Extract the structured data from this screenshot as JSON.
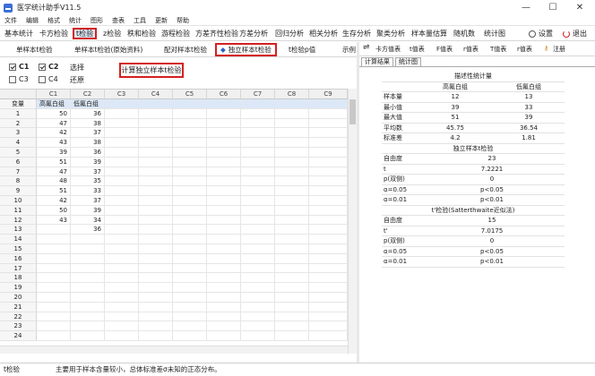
{
  "window": {
    "title": "医学统计助手V11.5",
    "minimize": "—",
    "maximize": "☐",
    "close": "✕"
  },
  "menu": [
    "文件",
    "编辑",
    "格式",
    "统计",
    "图形",
    "查表",
    "工具",
    "更新",
    "帮助"
  ],
  "toolbar": {
    "items": [
      "基本统计",
      "卡方检验",
      "t检验",
      "z检验",
      "秩和检验",
      "游程检验",
      "方差齐性检验",
      "方差分析",
      "回归分析",
      "相关分析",
      "生存分析",
      "聚类分析",
      "样本量估算",
      "随机数",
      "统计图"
    ],
    "active": "t检验",
    "settings": "设置",
    "exit": "退出"
  },
  "subtabs": {
    "items": [
      "单样本t检验",
      "单样本t检验(原始资料)",
      "配对样本t检验",
      "独立样本t检验",
      "t检验p值",
      "示例"
    ],
    "active": "独立样本t检验",
    "active_marker": "◆"
  },
  "options": {
    "c1": {
      "label": "C1",
      "checked": true
    },
    "c2": {
      "label": "C2",
      "checked": true
    },
    "c3": {
      "label": "C3",
      "checked": false
    },
    "c4": {
      "label": "C4",
      "checked": false
    },
    "select": "选择",
    "restore": "还原",
    "calc_button": "计算独立样本t检验"
  },
  "grid": {
    "columns": [
      "C1",
      "C2",
      "C3",
      "C4",
      "C5",
      "C6",
      "C7",
      "C8",
      "C9"
    ],
    "row_header": "变量",
    "var_names": [
      "高氟白组",
      "低氟白组"
    ],
    "c1": [
      50,
      47,
      42,
      43,
      39,
      51,
      47,
      48,
      51,
      42,
      50,
      43,
      ""
    ],
    "c2": [
      36,
      38,
      37,
      38,
      36,
      39,
      37,
      35,
      33,
      37,
      39,
      34,
      36
    ],
    "row_count": 24
  },
  "right_toolbar": {
    "swap": "⇌",
    "items": [
      "卡方值表",
      "t值表",
      "F值表",
      "r值表",
      "T值表",
      "r值表"
    ],
    "register": "注册"
  },
  "result_tabs": [
    "计算结果",
    "统计图"
  ],
  "results": {
    "desc_title": "描述性统计量",
    "group1": "高氟白组",
    "group2": "低氟白组",
    "desc_rows": [
      {
        "label": "样本量",
        "v1": "12",
        "v2": "13"
      },
      {
        "label": "最小值",
        "v1": "39",
        "v2": "33"
      },
      {
        "label": "最大值",
        "v1": "51",
        "v2": "39"
      },
      {
        "label": "平均数",
        "v1": "45.75",
        "v2": "36.54"
      },
      {
        "label": "标准差",
        "v1": "4.2",
        "v2": "1.81"
      }
    ],
    "ttest_title": "独立样本t检验",
    "ttest_rows": [
      {
        "label": "自由度",
        "v": "23"
      },
      {
        "label": "t",
        "v": "7.2221"
      },
      {
        "label": "p(双侧)",
        "v": "0"
      },
      {
        "label": "α=0.05",
        "v": "p<0.05"
      },
      {
        "label": "α=0.01",
        "v": "p<0.01"
      }
    ],
    "welch_title": "t'检验(Satterthwaite近似法)",
    "welch_rows": [
      {
        "label": "自由度",
        "v": "15"
      },
      {
        "label": "t'",
        "v": "7.0175"
      },
      {
        "label": "p(双侧)",
        "v": "0"
      },
      {
        "label": "α=0.05",
        "v": "p<0.05"
      },
      {
        "label": "α=0.01",
        "v": "p<0.01"
      }
    ]
  },
  "status": {
    "left": "t检验",
    "text": "主要用于样本含量较小，总体标准差σ未知的正态分布。"
  }
}
